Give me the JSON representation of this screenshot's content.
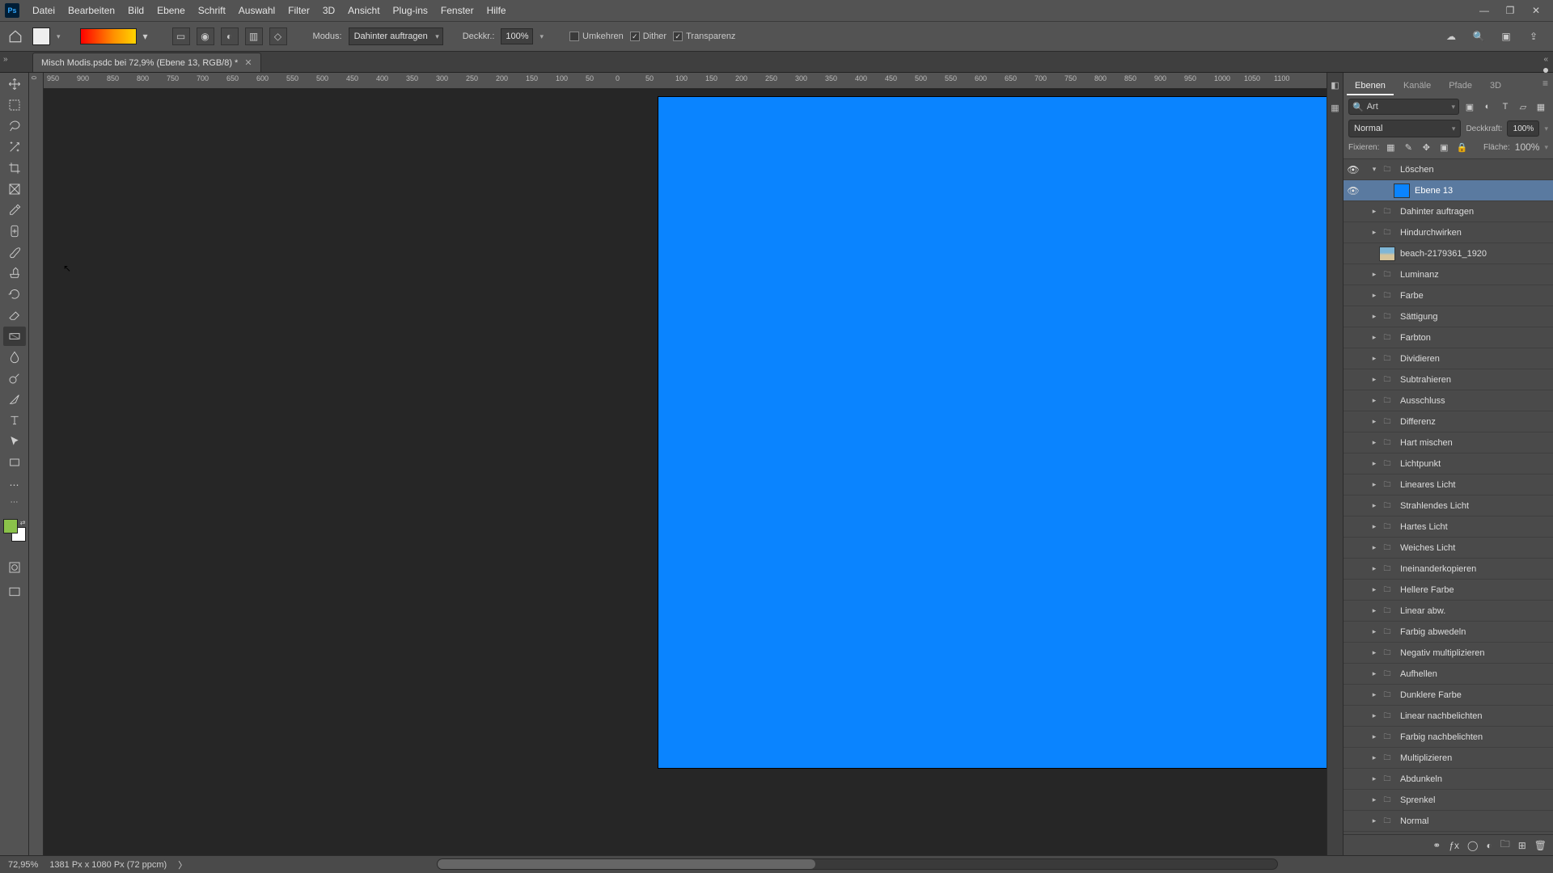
{
  "menubar": {
    "items": [
      "Datei",
      "Bearbeiten",
      "Bild",
      "Ebene",
      "Schrift",
      "Auswahl",
      "Filter",
      "3D",
      "Ansicht",
      "Plug-ins",
      "Fenster",
      "Hilfe"
    ]
  },
  "window_controls": {
    "min": "—",
    "max": "❐",
    "close": "✕"
  },
  "optbar": {
    "mode_label": "Modus:",
    "mode_value": "Dahinter auftragen",
    "opacity_label": "Deckkr.:",
    "opacity_value": "100%",
    "reverse": {
      "checked": false,
      "label": "Umkehren"
    },
    "dither": {
      "checked": true,
      "label": "Dither"
    },
    "transparency": {
      "checked": true,
      "label": "Transparenz"
    }
  },
  "doctab": {
    "title": "Misch Modis.psdc bei 72,9% (Ebene 13, RGB/8) *"
  },
  "ruler": {
    "h_ticks": [
      "950",
      "900",
      "850",
      "800",
      "750",
      "700",
      "650",
      "600",
      "550",
      "500",
      "450",
      "400",
      "350",
      "300",
      "250",
      "200",
      "150",
      "100",
      "50",
      "0",
      "50",
      "100",
      "150",
      "200",
      "250",
      "300",
      "350",
      "400",
      "450",
      "500",
      "550",
      "600",
      "650",
      "700",
      "750",
      "800",
      "850",
      "900",
      "950",
      "1000",
      "1050",
      "1100"
    ],
    "v_zero": "0"
  },
  "panels": {
    "tabs": [
      "Ebenen",
      "Kanäle",
      "Pfade",
      "3D"
    ],
    "active_tab": 0,
    "search_label": "Art",
    "blend_mode": "Normal",
    "opacity_label": "Deckkraft:",
    "opacity_value": "100%",
    "lock_label": "Fixieren:",
    "fill_label": "Fläche:",
    "fill_value": "100%"
  },
  "layers": [
    {
      "vis": true,
      "indent": 0,
      "twisty": "▾",
      "kind": "folder",
      "name": "Löschen"
    },
    {
      "vis": true,
      "indent": 1,
      "twisty": "",
      "kind": "blue",
      "name": "Ebene 13",
      "selected": true
    },
    {
      "vis": false,
      "indent": 0,
      "twisty": "▸",
      "kind": "folder",
      "name": "Dahinter auftragen"
    },
    {
      "vis": false,
      "indent": 0,
      "twisty": "▸",
      "kind": "folder",
      "name": "Hindurchwirken"
    },
    {
      "vis": false,
      "indent": 0,
      "twisty": "",
      "kind": "img",
      "name": "beach-2179361_1920"
    },
    {
      "vis": false,
      "indent": 0,
      "twisty": "▸",
      "kind": "folder",
      "name": "Luminanz"
    },
    {
      "vis": false,
      "indent": 0,
      "twisty": "▸",
      "kind": "folder",
      "name": "Farbe"
    },
    {
      "vis": false,
      "indent": 0,
      "twisty": "▸",
      "kind": "folder",
      "name": "Sättigung"
    },
    {
      "vis": false,
      "indent": 0,
      "twisty": "▸",
      "kind": "folder",
      "name": "Farbton"
    },
    {
      "vis": false,
      "indent": 0,
      "twisty": "▸",
      "kind": "folder",
      "name": "Dividieren"
    },
    {
      "vis": false,
      "indent": 0,
      "twisty": "▸",
      "kind": "folder",
      "name": "Subtrahieren"
    },
    {
      "vis": false,
      "indent": 0,
      "twisty": "▸",
      "kind": "folder",
      "name": "Ausschluss"
    },
    {
      "vis": false,
      "indent": 0,
      "twisty": "▸",
      "kind": "folder",
      "name": "Differenz"
    },
    {
      "vis": false,
      "indent": 0,
      "twisty": "▸",
      "kind": "folder",
      "name": "Hart mischen"
    },
    {
      "vis": false,
      "indent": 0,
      "twisty": "▸",
      "kind": "folder",
      "name": "Lichtpunkt"
    },
    {
      "vis": false,
      "indent": 0,
      "twisty": "▸",
      "kind": "folder",
      "name": "Lineares Licht"
    },
    {
      "vis": false,
      "indent": 0,
      "twisty": "▸",
      "kind": "folder",
      "name": "Strahlendes Licht"
    },
    {
      "vis": false,
      "indent": 0,
      "twisty": "▸",
      "kind": "folder",
      "name": "Hartes Licht"
    },
    {
      "vis": false,
      "indent": 0,
      "twisty": "▸",
      "kind": "folder",
      "name": "Weiches Licht"
    },
    {
      "vis": false,
      "indent": 0,
      "twisty": "▸",
      "kind": "folder",
      "name": "Ineinanderkopieren"
    },
    {
      "vis": false,
      "indent": 0,
      "twisty": "▸",
      "kind": "folder",
      "name": "Hellere Farbe"
    },
    {
      "vis": false,
      "indent": 0,
      "twisty": "▸",
      "kind": "folder",
      "name": "Linear abw."
    },
    {
      "vis": false,
      "indent": 0,
      "twisty": "▸",
      "kind": "folder",
      "name": "Farbig abwedeln"
    },
    {
      "vis": false,
      "indent": 0,
      "twisty": "▸",
      "kind": "folder",
      "name": "Negativ multiplizieren"
    },
    {
      "vis": false,
      "indent": 0,
      "twisty": "▸",
      "kind": "folder",
      "name": "Aufhellen"
    },
    {
      "vis": false,
      "indent": 0,
      "twisty": "▸",
      "kind": "folder",
      "name": "Dunklere Farbe"
    },
    {
      "vis": false,
      "indent": 0,
      "twisty": "▸",
      "kind": "folder",
      "name": "Linear nachbelichten"
    },
    {
      "vis": false,
      "indent": 0,
      "twisty": "▸",
      "kind": "folder",
      "name": "Farbig nachbelichten"
    },
    {
      "vis": false,
      "indent": 0,
      "twisty": "▸",
      "kind": "folder",
      "name": "Multiplizieren"
    },
    {
      "vis": false,
      "indent": 0,
      "twisty": "▸",
      "kind": "folder",
      "name": "Abdunkeln"
    },
    {
      "vis": false,
      "indent": 0,
      "twisty": "▸",
      "kind": "folder",
      "name": "Sprenkel"
    },
    {
      "vis": false,
      "indent": 0,
      "twisty": "▸",
      "kind": "folder",
      "name": "Normal"
    }
  ],
  "statusbar": {
    "zoom": "72,95%",
    "doc_info": "1381 Px x 1080 Px (72 ppcm)",
    "arrow": "〉"
  }
}
